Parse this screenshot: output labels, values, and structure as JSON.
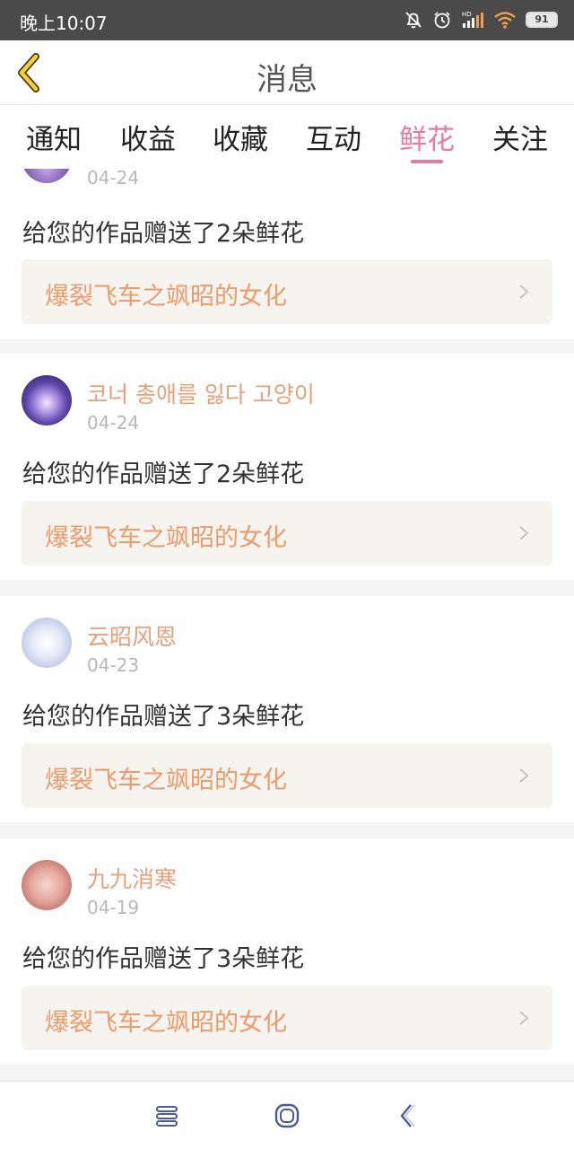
{
  "status_bar": {
    "time": "晚上10:07",
    "battery": "91",
    "icons": [
      "bell-off-icon",
      "alarm-icon",
      "hd-signal-icon",
      "wifi-icon",
      "battery-icon"
    ]
  },
  "header": {
    "title": "消息",
    "back_icon": "back-arrow-icon"
  },
  "tabs": [
    {
      "label": "通知",
      "active": false
    },
    {
      "label": "收益",
      "active": false
    },
    {
      "label": "收藏",
      "active": false
    },
    {
      "label": "互动",
      "active": false
    },
    {
      "label": "鲜花",
      "active": true
    },
    {
      "label": "关注",
      "active": false
    }
  ],
  "colors": {
    "accent": "#e57aa3",
    "username": "#e8a07a",
    "work_title": "#ef9a6a",
    "work_box_bg": "#f5f4ee",
    "separator": "#f5f5f5",
    "status_bar": "#4a4a4a"
  },
  "feed": [
    {
      "username": "",
      "date": "04-24",
      "message": "给您的作品赠送了2朵鲜花",
      "work_title": "爆裂飞车之飒昭的女化"
    },
    {
      "username": "코너 총애를 잃다 고양이",
      "date": "04-24",
      "message": "给您的作品赠送了2朵鲜花",
      "work_title": "爆裂飞车之飒昭的女化"
    },
    {
      "username": "云昭风恩",
      "date": "04-23",
      "message": "给您的作品赠送了3朵鲜花",
      "work_title": "爆裂飞车之飒昭的女化"
    },
    {
      "username": "九九消寒",
      "date": "04-19",
      "message": "给您的作品赠送了3朵鲜花",
      "work_title": "爆裂飞车之飒昭的女化"
    }
  ],
  "nav_bar": {
    "icons": [
      "menu-icon",
      "home-icon",
      "back-icon"
    ]
  }
}
